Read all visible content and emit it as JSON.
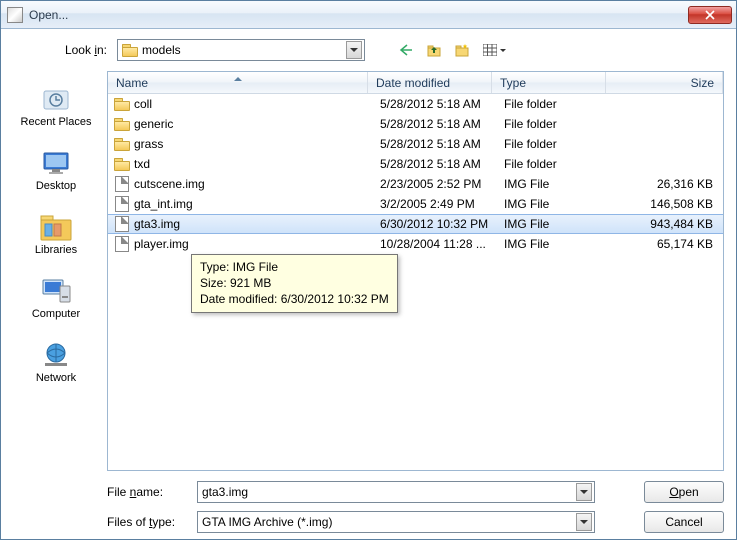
{
  "window": {
    "title": "Open..."
  },
  "lookin": {
    "label_pre": "Look ",
    "label_hot": "i",
    "label_post": "n:",
    "value": "models"
  },
  "places": [
    {
      "id": "recent",
      "label": "Recent Places"
    },
    {
      "id": "desktop",
      "label": "Desktop"
    },
    {
      "id": "libraries",
      "label": "Libraries"
    },
    {
      "id": "computer",
      "label": "Computer"
    },
    {
      "id": "network",
      "label": "Network"
    }
  ],
  "columns": {
    "name": "Name",
    "date": "Date modified",
    "type": "Type",
    "size": "Size"
  },
  "rows": [
    {
      "icon": "folder",
      "name": "coll",
      "date": "5/28/2012 5:18 AM",
      "type": "File folder",
      "size": ""
    },
    {
      "icon": "folder",
      "name": "generic",
      "date": "5/28/2012 5:18 AM",
      "type": "File folder",
      "size": ""
    },
    {
      "icon": "folder",
      "name": "grass",
      "date": "5/28/2012 5:18 AM",
      "type": "File folder",
      "size": ""
    },
    {
      "icon": "folder",
      "name": "txd",
      "date": "5/28/2012 5:18 AM",
      "type": "File folder",
      "size": ""
    },
    {
      "icon": "file",
      "name": "cutscene.img",
      "date": "2/23/2005 2:52 PM",
      "type": "IMG File",
      "size": "26,316 KB"
    },
    {
      "icon": "file",
      "name": "gta_int.img",
      "date": "3/2/2005 2:49 PM",
      "type": "IMG File",
      "size": "146,508 KB"
    },
    {
      "icon": "file",
      "name": "gta3.img",
      "date": "6/30/2012 10:32 PM",
      "type": "IMG File",
      "size": "943,484 KB",
      "selected": true
    },
    {
      "icon": "file",
      "name": "player.img",
      "date": "10/28/2004 11:28 ...",
      "type": "IMG File",
      "size": "65,174 KB"
    }
  ],
  "tooltip": {
    "line1": "Type: IMG File",
    "line2": "Size: 921 MB",
    "line3": "Date modified: 6/30/2012 10:32 PM"
  },
  "filename": {
    "label_pre": "File ",
    "label_hot": "n",
    "label_post": "ame:",
    "value": "gta3.img"
  },
  "filetype": {
    "label_pre": "Files of ",
    "label_hot": "t",
    "label_post": "ype:",
    "value": "GTA IMG Archive (*.img)"
  },
  "buttons": {
    "open_hot": "O",
    "open_rest": "pen",
    "cancel": "Cancel"
  }
}
